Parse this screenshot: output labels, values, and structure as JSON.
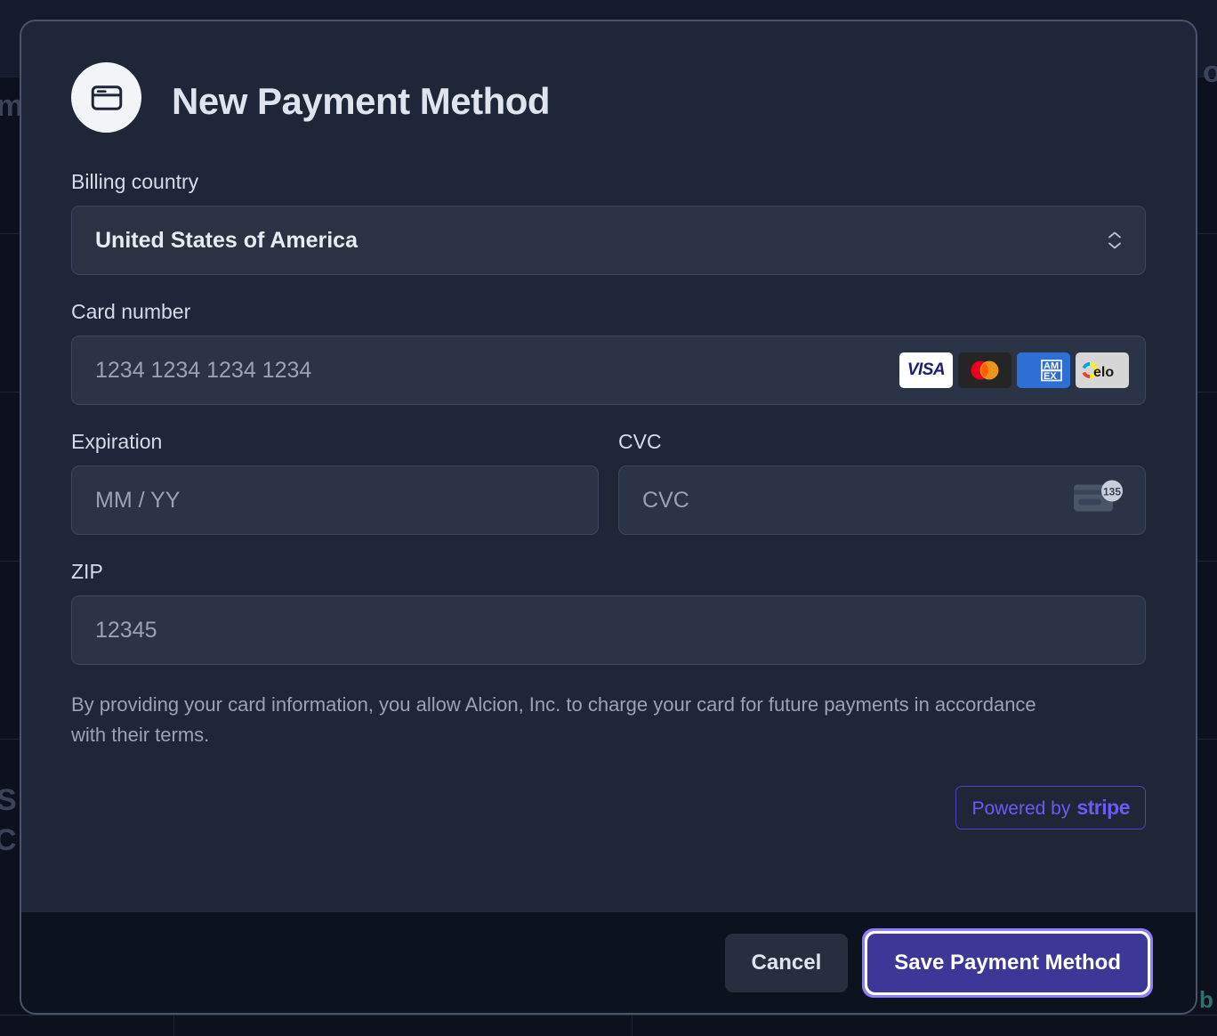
{
  "modal": {
    "title": "New Payment Method",
    "header_icon": "credit-card-icon",
    "fields": {
      "billing_country": {
        "label": "Billing country",
        "value": "United States of America",
        "chevron_icon": "chevron-up-down-icon"
      },
      "card_number": {
        "label": "Card number",
        "placeholder": "1234 1234 1234 1234",
        "value": "",
        "brands": [
          {
            "name": "visa-logo",
            "text": "VISA"
          },
          {
            "name": "mastercard-logo",
            "text": ""
          },
          {
            "name": "amex-logo",
            "text": "AMEX"
          },
          {
            "name": "elo-logo",
            "text": "elo"
          }
        ]
      },
      "expiration": {
        "label": "Expiration",
        "placeholder": "MM / YY",
        "value": ""
      },
      "cvc": {
        "label": "CVC",
        "placeholder": "CVC",
        "value": "",
        "hint_icon": "cvc-card-icon",
        "hint_number": "135"
      },
      "zip": {
        "label": "ZIP",
        "placeholder": "12345",
        "value": ""
      }
    },
    "disclaimer": "By providing your card information, you allow Alcion, Inc. to charge your card for future payments in accordance with their terms.",
    "stripe_badge": {
      "prefix": "Powered by",
      "brand": "stripe"
    },
    "footer": {
      "cancel_label": "Cancel",
      "save_label": "Save Payment Method"
    }
  },
  "colors": {
    "modal_bg": "#1e2637",
    "footer_bg": "#0d121f",
    "input_bg": "#2b3346",
    "accent_purple": "#6a5cf0",
    "save_button_bg": "#3d3898",
    "focus_ring": "#8b7dfb"
  },
  "background": {
    "ghost_left_top": "m",
    "ghost_left_mid": "S",
    "ghost_left_low": "C",
    "ghost_right_top": "o",
    "ghost_right_teal": "b"
  }
}
